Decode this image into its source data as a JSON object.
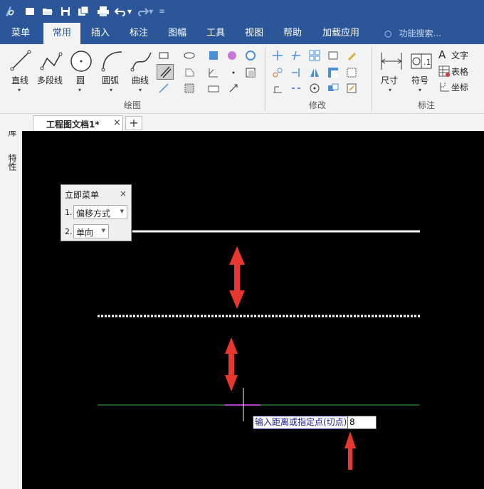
{
  "titlebar": {
    "icons": [
      "app-logo-icon",
      "new-file-icon",
      "open-folder-icon",
      "save-icon",
      "save-all-icon",
      "print-icon",
      "undo-icon",
      "redo-icon",
      "customize-icon"
    ]
  },
  "menu": {
    "items": [
      "菜单",
      "常用",
      "插入",
      "标注",
      "图幅",
      "工具",
      "视图",
      "帮助",
      "加载应用"
    ],
    "active": "常用",
    "search_placeholder": "功能搜索..."
  },
  "ribbon": {
    "draw": {
      "group_label": "绘图",
      "line": "直线",
      "polyline": "多段线",
      "circle": "圆",
      "arc": "圆弧",
      "curve": "曲线"
    },
    "modify": {
      "group_label": "修改"
    },
    "annotate": {
      "group_label": "标注",
      "dimension": "尺寸",
      "symbol": "符号",
      "text": "文字",
      "table": "表格",
      "coordinate": "坐标"
    }
  },
  "document": {
    "tab_label": "工程图文档1*",
    "close_glyph": "×",
    "add_glyph": "+"
  },
  "left_dock": {
    "panel1": "图库",
    "panel2": "特性"
  },
  "immediate_menu": {
    "title": "立即菜单",
    "close_glyph": "×",
    "items": [
      {
        "num": "1.",
        "value": "偏移方式"
      },
      {
        "num": "2.",
        "value": "单向"
      }
    ]
  },
  "command": {
    "prompt": "输入距离或指定点(切点)",
    "input_value": "8"
  },
  "colors": {
    "title_bar": "#2b579a",
    "canvas": "#000000",
    "annotation_arrow": "#e8372f",
    "offset_line": "#3cb043",
    "highlight_segment": "#b03cc9"
  }
}
